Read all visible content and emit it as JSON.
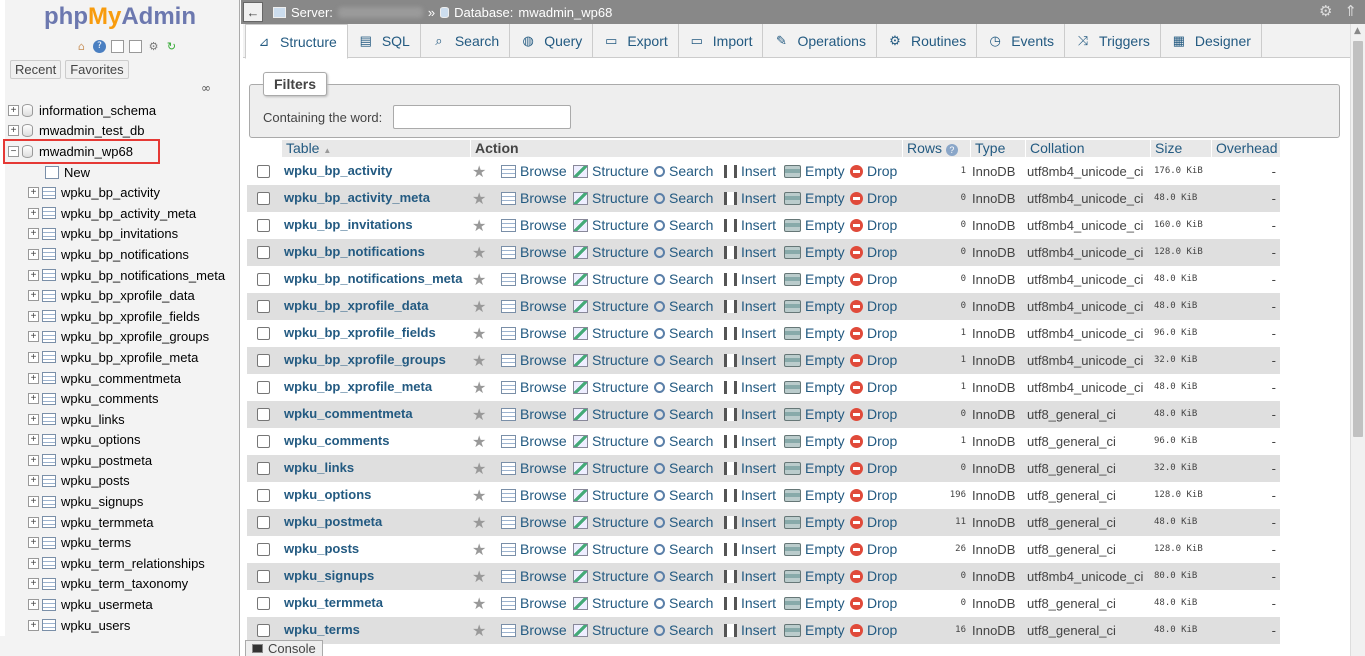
{
  "logo": {
    "php": "php",
    "my": "My",
    "admin": "Admin"
  },
  "nav": {
    "tabs": [
      "Recent",
      "Favorites"
    ],
    "databases": [
      {
        "name": "information_schema"
      },
      {
        "name": "mwadmin_test_db"
      },
      {
        "name": "mwadmin_wp68"
      }
    ],
    "new_label": "New",
    "tables": [
      "wpku_bp_activity",
      "wpku_bp_activity_meta",
      "wpku_bp_invitations",
      "wpku_bp_notifications",
      "wpku_bp_notifications_meta",
      "wpku_bp_xprofile_data",
      "wpku_bp_xprofile_fields",
      "wpku_bp_xprofile_groups",
      "wpku_bp_xprofile_meta",
      "wpku_commentmeta",
      "wpku_comments",
      "wpku_links",
      "wpku_options",
      "wpku_postmeta",
      "wpku_posts",
      "wpku_signups",
      "wpku_termmeta",
      "wpku_terms",
      "wpku_term_relationships",
      "wpku_term_taxonomy",
      "wpku_usermeta",
      "wpku_users"
    ]
  },
  "topbar": {
    "server_label": "Server:",
    "separator": "»",
    "database_label": "Database:",
    "database": "mwadmin_wp68"
  },
  "menu": [
    {
      "label": "Structure",
      "icon": "structure-icon",
      "active": true
    },
    {
      "label": "SQL",
      "icon": "sql-icon"
    },
    {
      "label": "Search",
      "icon": "search-icon"
    },
    {
      "label": "Query",
      "icon": "query-icon"
    },
    {
      "label": "Export",
      "icon": "export-icon"
    },
    {
      "label": "Import",
      "icon": "import-icon"
    },
    {
      "label": "Operations",
      "icon": "wrench-icon"
    },
    {
      "label": "Routines",
      "icon": "routines-icon"
    },
    {
      "label": "Events",
      "icon": "clock-icon"
    },
    {
      "label": "Triggers",
      "icon": "triggers-icon"
    },
    {
      "label": "Designer",
      "icon": "designer-icon"
    }
  ],
  "filters": {
    "legend": "Filters",
    "label": "Containing the word:",
    "value": ""
  },
  "table": {
    "headers": {
      "table": "Table",
      "sort": "▲",
      "action": "Action",
      "rows": "Rows",
      "type": "Type",
      "collation": "Collation",
      "size": "Size",
      "overhead": "Overhead"
    },
    "actions": [
      "Browse",
      "Structure",
      "Search",
      "Insert",
      "Empty",
      "Drop"
    ],
    "rows": [
      {
        "name": "wpku_bp_activity",
        "rows": "1",
        "type": "InnoDB",
        "collation": "utf8mb4_unicode_ci",
        "size": "176.0 KiB",
        "overhead": "-"
      },
      {
        "name": "wpku_bp_activity_meta",
        "rows": "0",
        "type": "InnoDB",
        "collation": "utf8mb4_unicode_ci",
        "size": "48.0 KiB",
        "overhead": "-"
      },
      {
        "name": "wpku_bp_invitations",
        "rows": "0",
        "type": "InnoDB",
        "collation": "utf8mb4_unicode_ci",
        "size": "160.0 KiB",
        "overhead": "-"
      },
      {
        "name": "wpku_bp_notifications",
        "rows": "0",
        "type": "InnoDB",
        "collation": "utf8mb4_unicode_ci",
        "size": "128.0 KiB",
        "overhead": "-"
      },
      {
        "name": "wpku_bp_notifications_meta",
        "rows": "0",
        "type": "InnoDB",
        "collation": "utf8mb4_unicode_ci",
        "size": "48.0 KiB",
        "overhead": "-"
      },
      {
        "name": "wpku_bp_xprofile_data",
        "rows": "0",
        "type": "InnoDB",
        "collation": "utf8mb4_unicode_ci",
        "size": "48.0 KiB",
        "overhead": "-"
      },
      {
        "name": "wpku_bp_xprofile_fields",
        "rows": "1",
        "type": "InnoDB",
        "collation": "utf8mb4_unicode_ci",
        "size": "96.0 KiB",
        "overhead": "-"
      },
      {
        "name": "wpku_bp_xprofile_groups",
        "rows": "1",
        "type": "InnoDB",
        "collation": "utf8mb4_unicode_ci",
        "size": "32.0 KiB",
        "overhead": "-"
      },
      {
        "name": "wpku_bp_xprofile_meta",
        "rows": "1",
        "type": "InnoDB",
        "collation": "utf8mb4_unicode_ci",
        "size": "48.0 KiB",
        "overhead": "-"
      },
      {
        "name": "wpku_commentmeta",
        "rows": "0",
        "type": "InnoDB",
        "collation": "utf8_general_ci",
        "size": "48.0 KiB",
        "overhead": "-"
      },
      {
        "name": "wpku_comments",
        "rows": "1",
        "type": "InnoDB",
        "collation": "utf8_general_ci",
        "size": "96.0 KiB",
        "overhead": "-"
      },
      {
        "name": "wpku_links",
        "rows": "0",
        "type": "InnoDB",
        "collation": "utf8_general_ci",
        "size": "32.0 KiB",
        "overhead": "-"
      },
      {
        "name": "wpku_options",
        "rows": "196",
        "type": "InnoDB",
        "collation": "utf8_general_ci",
        "size": "128.0 KiB",
        "overhead": "-"
      },
      {
        "name": "wpku_postmeta",
        "rows": "11",
        "type": "InnoDB",
        "collation": "utf8_general_ci",
        "size": "48.0 KiB",
        "overhead": "-"
      },
      {
        "name": "wpku_posts",
        "rows": "26",
        "type": "InnoDB",
        "collation": "utf8_general_ci",
        "size": "128.0 KiB",
        "overhead": "-"
      },
      {
        "name": "wpku_signups",
        "rows": "0",
        "type": "InnoDB",
        "collation": "utf8mb4_unicode_ci",
        "size": "80.0 KiB",
        "overhead": "-"
      },
      {
        "name": "wpku_termmeta",
        "rows": "0",
        "type": "InnoDB",
        "collation": "utf8_general_ci",
        "size": "48.0 KiB",
        "overhead": "-"
      },
      {
        "name": "wpku_terms",
        "rows": "16",
        "type": "InnoDB",
        "collation": "utf8_general_ci",
        "size": "48.0 KiB",
        "overhead": "-"
      }
    ]
  },
  "console": {
    "label": "Console"
  },
  "colors": {
    "accent": "#235a81",
    "stripe": "#dfdfdf",
    "drop": "#e04a3a",
    "topbar": "#888888",
    "highlight": "#e53935"
  }
}
